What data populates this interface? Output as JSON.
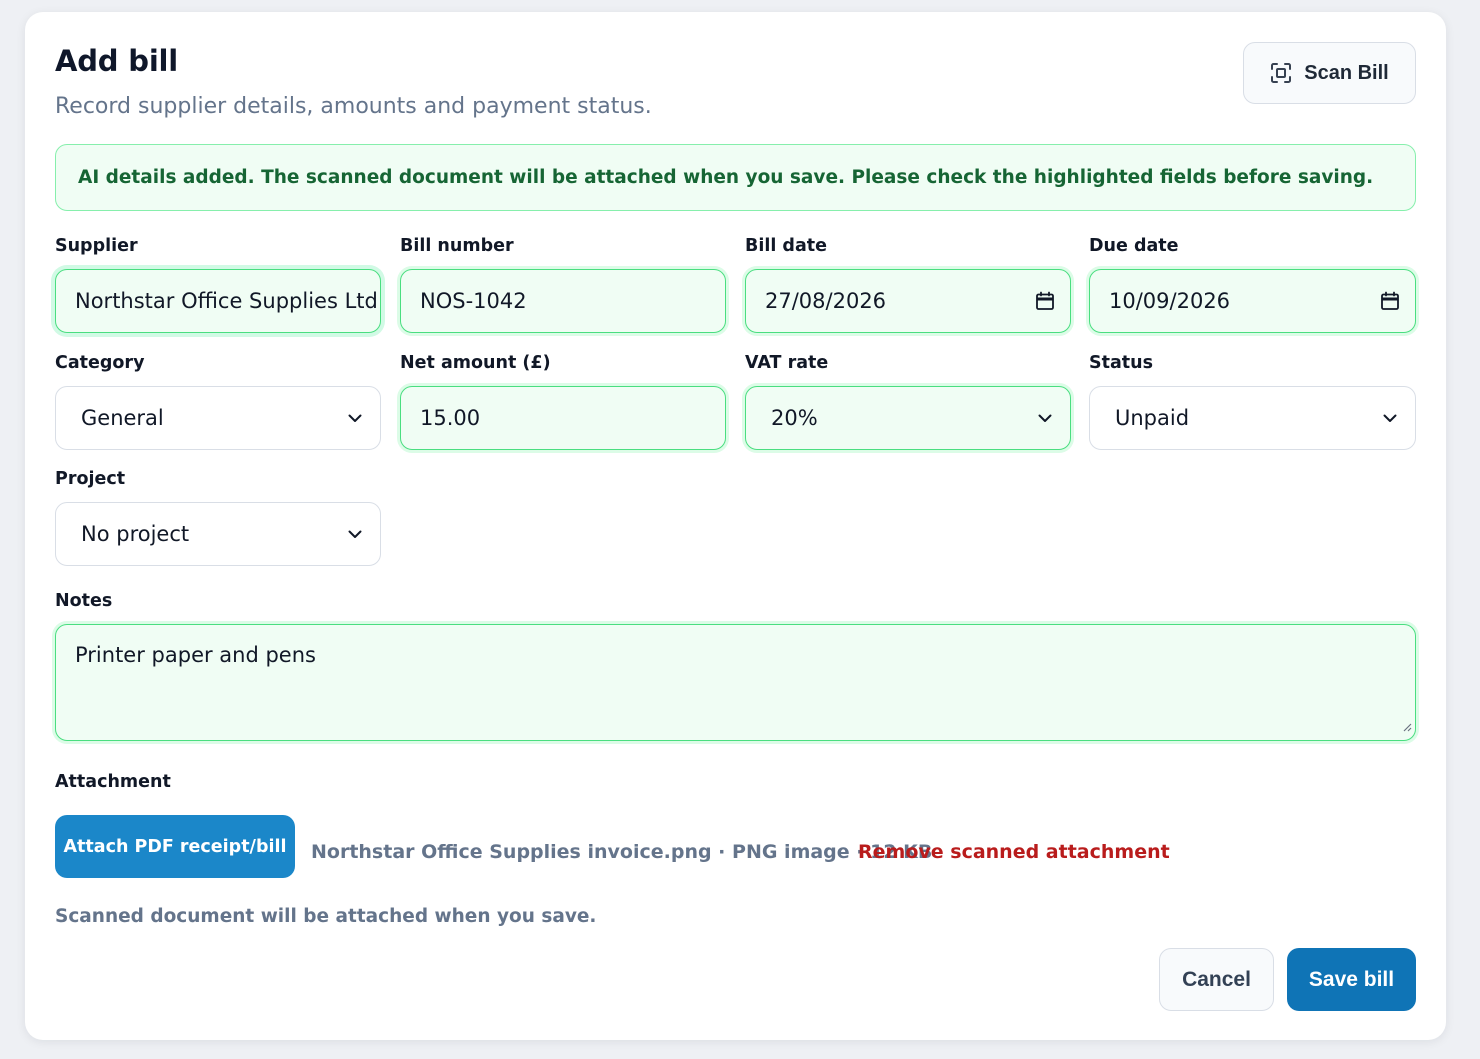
{
  "header": {
    "title": "Add bill",
    "subtitle": "Record supplier details, amounts and payment status.",
    "scan_button": {
      "label": "Scan Bill",
      "icon": "scan-icon"
    }
  },
  "alert": {
    "text": "AI details added. The scanned document will be attached when you save. Please check the highlighted fields before saving.",
    "color": "#166534",
    "background": "#f0fdf4"
  },
  "fields": {
    "supplier": {
      "label": "Supplier",
      "value": "Northstar Office Supplies Ltd",
      "highlighted": true
    },
    "bill_number": {
      "label": "Bill number",
      "value": "NOS-1042",
      "highlighted": true
    },
    "bill_date": {
      "label": "Bill date",
      "value": "27/08/2026",
      "highlighted": true,
      "icon": "calendar-icon"
    },
    "due_date": {
      "label": "Due date",
      "value": "10/09/2026",
      "highlighted": true,
      "icon": "calendar-icon"
    },
    "category": {
      "label": "Category",
      "value": "General",
      "highlighted": false
    },
    "net_amount": {
      "label": "Net amount (£)",
      "value": "15.00",
      "highlighted": true
    },
    "vat_rate": {
      "label": "VAT rate",
      "value": "20%",
      "highlighted": true
    },
    "status": {
      "label": "Status",
      "value": "Unpaid",
      "highlighted": false
    },
    "project": {
      "label": "Project",
      "value": "No project",
      "highlighted": false
    },
    "notes": {
      "label": "Notes",
      "value": "Printer paper and pens",
      "highlighted": true
    }
  },
  "attachment": {
    "label": "Attachment",
    "button_label": "Attach PDF receipt/bill",
    "file_info": "Northstar Office Supplies invoice.png · PNG image · 12 KB",
    "remove_label": "Remove scanned attachment",
    "hint": "Scanned document will be attached when you save."
  },
  "actions": {
    "cancel_label": "Cancel",
    "save_label": "Save bill",
    "primary_color": "#0f74b6"
  }
}
